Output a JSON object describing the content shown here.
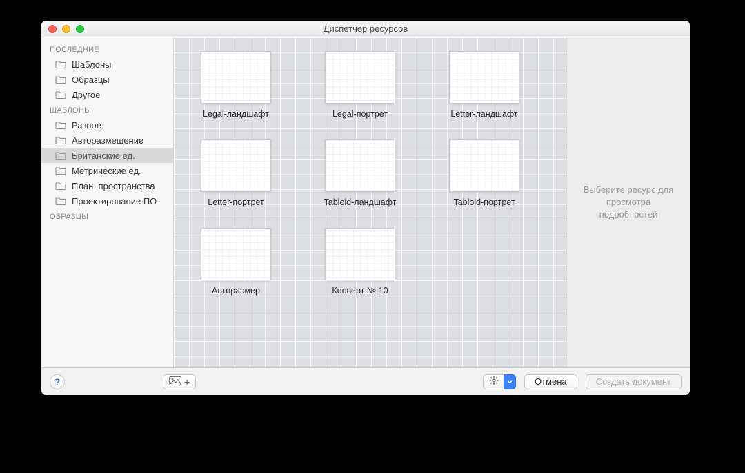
{
  "window": {
    "title": "Диспетчер ресурсов"
  },
  "sidebar": {
    "sections": [
      {
        "heading": "ПОСЛЕДНИЕ",
        "items": [
          {
            "label": "Шаблоны",
            "selected": false
          },
          {
            "label": "Образцы",
            "selected": false
          },
          {
            "label": "Другое",
            "selected": false
          }
        ]
      },
      {
        "heading": "ШАБЛОНЫ",
        "items": [
          {
            "label": "Разное",
            "selected": false
          },
          {
            "label": "Авторазмещение",
            "selected": false
          },
          {
            "label": "Британские ед.",
            "selected": true
          },
          {
            "label": "Метрические ед.",
            "selected": false
          },
          {
            "label": "План. пространства",
            "selected": false
          },
          {
            "label": "Проектирование ПО",
            "selected": false
          }
        ]
      },
      {
        "heading": "ОБРАЗЦЫ",
        "items": []
      }
    ]
  },
  "templates": [
    {
      "label": "Legal-ландшафт"
    },
    {
      "label": "Legal-портрет"
    },
    {
      "label": "Letter-ландшафт"
    },
    {
      "label": "Letter-портрет"
    },
    {
      "label": "Tabloid-ландшафт"
    },
    {
      "label": "Tabloid-портрет"
    },
    {
      "label": "Автораэмер"
    },
    {
      "label": "Конверт № 10"
    }
  ],
  "details": {
    "placeholder": "Выберите ресурс для просмотра подробностей"
  },
  "footer": {
    "help": "?",
    "cancel": "Отмена",
    "create": "Создать документ"
  }
}
